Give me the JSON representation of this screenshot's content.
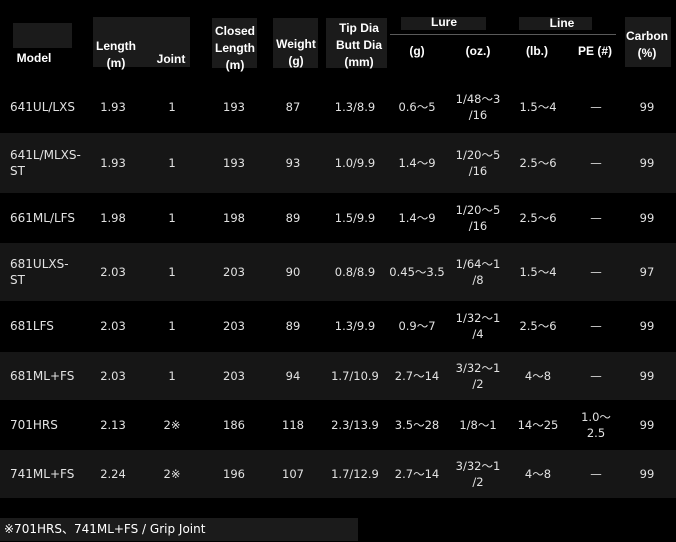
{
  "table": {
    "headers": {
      "model": "Model",
      "length": "Length\n(m)",
      "joint": "Joint",
      "closed_length": "Closed\nLength\n(m)",
      "weight": "Weight\n(g)",
      "tip_butt": "Tip Dia\nButt Dia\n(mm)",
      "lure": "Lure",
      "lure_g": "(g)",
      "lure_oz": "(oz.)",
      "line": "Line",
      "line_lb": "(lb.)",
      "line_pe": "PE (#)",
      "carbon": "Carbon\n(%)"
    },
    "rows": [
      {
        "model": "641UL/LXS",
        "length": "1.93",
        "joint": "1",
        "closed": "193",
        "weight": "87",
        "tipbutt": "1.3/8.9",
        "lure_g": "0.6～5",
        "lure_oz": "1/48～3\n/16",
        "line_lb": "1.5～4",
        "line_pe": "—",
        "carbon": "99"
      },
      {
        "model": "641L/MLXS-\nST",
        "length": "1.93",
        "joint": "1",
        "closed": "193",
        "weight": "93",
        "tipbutt": "1.0/9.9",
        "lure_g": "1.4～9",
        "lure_oz": "1/20～5\n/16",
        "line_lb": "2.5～6",
        "line_pe": "—",
        "carbon": "99"
      },
      {
        "model": "661ML/LFS",
        "length": "1.98",
        "joint": "1",
        "closed": "198",
        "weight": "89",
        "tipbutt": "1.5/9.9",
        "lure_g": "1.4～9",
        "lure_oz": "1/20～5\n/16",
        "line_lb": "2.5～6",
        "line_pe": "—",
        "carbon": "99"
      },
      {
        "model": "681ULXS-\nST",
        "length": "2.03",
        "joint": "1",
        "closed": "203",
        "weight": "90",
        "tipbutt": "0.8/8.9",
        "lure_g": "0.45～3.5",
        "lure_oz": "1/64～1\n/8",
        "line_lb": "1.5～4",
        "line_pe": "—",
        "carbon": "97"
      },
      {
        "model": "681LFS",
        "length": "2.03",
        "joint": "1",
        "closed": "203",
        "weight": "89",
        "tipbutt": "1.3/9.9",
        "lure_g": "0.9～7",
        "lure_oz": "1/32～1\n/4",
        "line_lb": "2.5～6",
        "line_pe": "—",
        "carbon": "99"
      },
      {
        "model": "681ML+FS",
        "length": "2.03",
        "joint": "1",
        "closed": "203",
        "weight": "94",
        "tipbutt": "1.7/10.9",
        "lure_g": "2.7～14",
        "lure_oz": "3/32～1\n/2",
        "line_lb": "4～8",
        "line_pe": "—",
        "carbon": "99"
      },
      {
        "model": "701HRS",
        "length": "2.13",
        "joint": "2※",
        "closed": "186",
        "weight": "118",
        "tipbutt": "2.3/13.9",
        "lure_g": "3.5～28",
        "lure_oz": "1/8～1",
        "line_lb": "14～25",
        "line_pe": "1.0～\n2.5",
        "carbon": "99"
      },
      {
        "model": "741ML+FS",
        "length": "2.24",
        "joint": "2※",
        "closed": "196",
        "weight": "107",
        "tipbutt": "1.7/12.9",
        "lure_g": "2.7～14",
        "lure_oz": "3/32～1\n/2",
        "line_lb": "4～8",
        "line_pe": "—",
        "carbon": "99"
      }
    ]
  },
  "footnote": "※701HRS、741ML+FS / Grip Joint"
}
